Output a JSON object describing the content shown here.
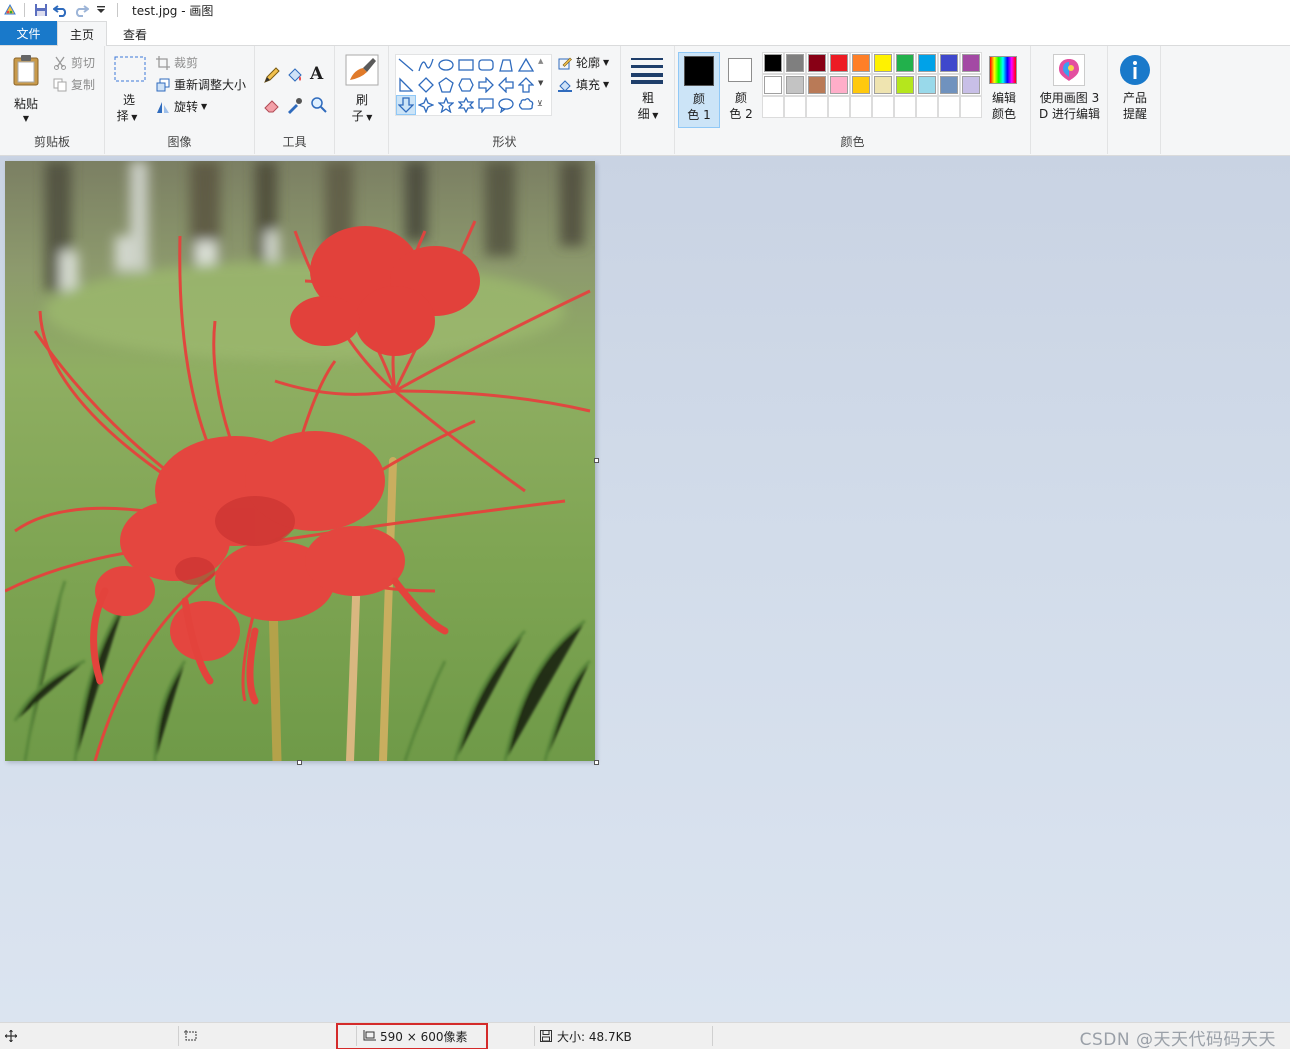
{
  "window": {
    "title": "test.jpg - 画图"
  },
  "tabs": {
    "file": "文件",
    "home": "主页",
    "view": "查看"
  },
  "clipboard": {
    "paste": "粘贴",
    "cut": "剪切",
    "copy": "复制",
    "label": "剪贴板"
  },
  "image": {
    "select_top": "选",
    "select_bottom": "择",
    "crop": "裁剪",
    "resize": "重新调整大小",
    "rotate": "旋转",
    "label": "图像"
  },
  "tools": {
    "label": "工具"
  },
  "brush": {
    "line1": "刷",
    "line2": "子"
  },
  "shapes": {
    "outline": "轮廓",
    "fill": "填充",
    "label": "形状"
  },
  "size": {
    "line1": "粗",
    "line2": "细"
  },
  "colors": {
    "color1_line1": "颜",
    "color1_line2": "色 1",
    "color2_line1": "颜",
    "color2_line2": "色 2",
    "edit_line1": "编辑",
    "edit_line2": "颜色",
    "label": "颜色",
    "color1_value": "#000000",
    "color2_value": "#ffffff",
    "palette_row1": [
      "#000000",
      "#7f7f7f",
      "#880015",
      "#ed1c24",
      "#ff7f27",
      "#fff200",
      "#22b14c",
      "#00a2e8",
      "#3f48cc",
      "#a349a4"
    ],
    "palette_row2": [
      "#ffffff",
      "#c3c3c3",
      "#b97a57",
      "#ffaec9",
      "#ffc90e",
      "#efe4b0",
      "#b5e61d",
      "#99d9ea",
      "#7092be",
      "#c8bfe7"
    ]
  },
  "paint3d": {
    "line1": "使用画图 3",
    "line2": "D 进行编辑"
  },
  "product": {
    "line1": "产品",
    "line2": "提醒"
  },
  "status": {
    "dimensions": "590 × 600像素",
    "size": "大小: 48.7KB",
    "watermark": "CSDN @天天代码码天天"
  },
  "accent_color": "#1979ca",
  "highlight_color": "#d42a2a"
}
